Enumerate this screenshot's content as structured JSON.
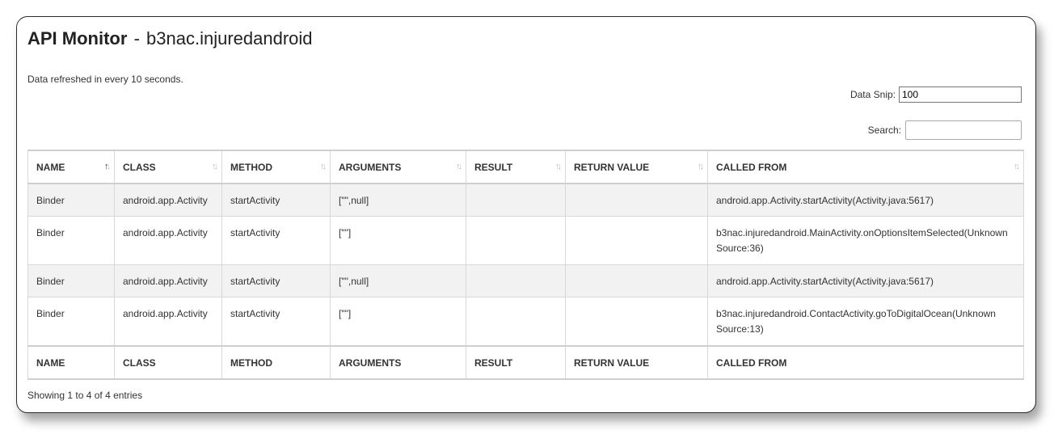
{
  "header": {
    "title_bold": "API Monitor",
    "title_separator": "-",
    "title_app": "b3nac.injuredandroid",
    "refresh_note": "Data refreshed in every 10 seconds."
  },
  "controls": {
    "data_snip_label": "Data Snip:",
    "data_snip_value": "100",
    "search_label": "Search:",
    "search_value": ""
  },
  "table": {
    "columns": [
      "NAME",
      "CLASS",
      "METHOD",
      "ARGUMENTS",
      "RESULT",
      "RETURN VALUE",
      "CALLED FROM"
    ],
    "sorted_column": "NAME",
    "rows": [
      [
        "Binder",
        "android.app.Activity",
        "startActivity",
        "[\"\",null]",
        "",
        "",
        "android.app.Activity.startActivity(Activity.java:5617)"
      ],
      [
        "Binder",
        "android.app.Activity",
        "startActivity",
        "[\"\"]",
        "",
        "",
        "b3nac.injuredandroid.MainActivity.onOptionsItemSelected(Unknown Source:36)"
      ],
      [
        "Binder",
        "android.app.Activity",
        "startActivity",
        "[\"\",null]",
        "",
        "",
        "android.app.Activity.startActivity(Activity.java:5617)"
      ],
      [
        "Binder",
        "android.app.Activity",
        "startActivity",
        "[\"\"]",
        "",
        "",
        "b3nac.injuredandroid.ContactActivity.goToDigitalOcean(Unknown Source:13)"
      ]
    ],
    "info": "Showing 1 to 4 of 4 entries"
  }
}
